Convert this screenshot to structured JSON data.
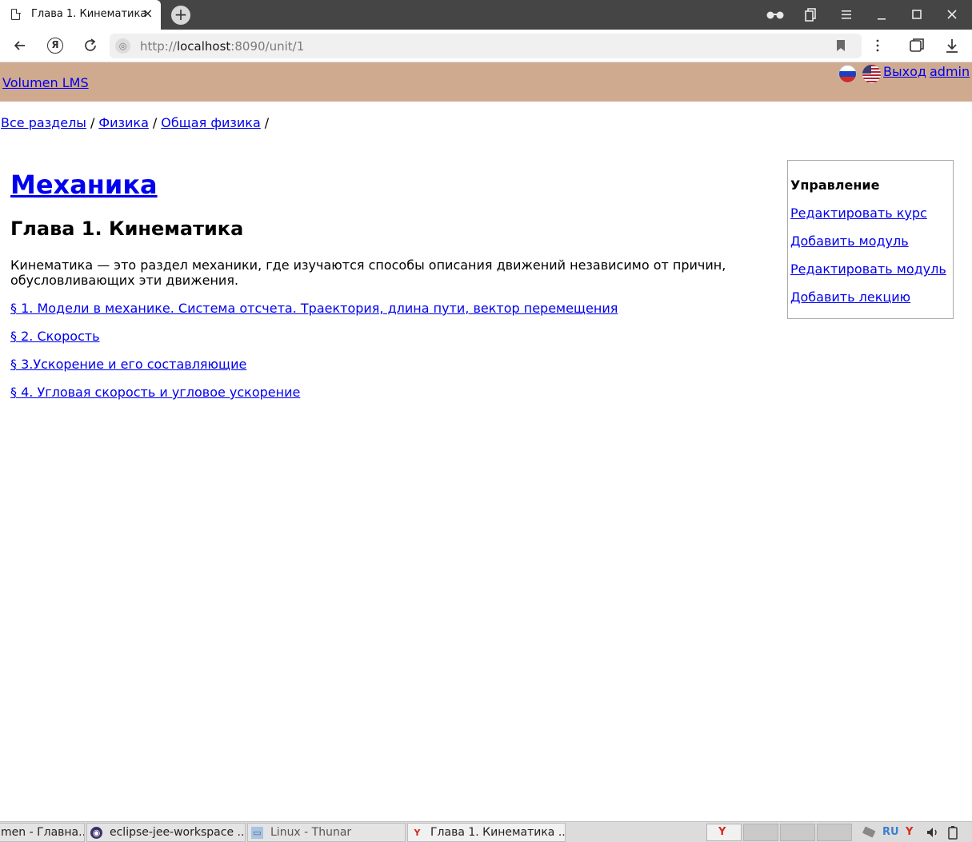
{
  "browser": {
    "tab_title": "Глава 1. Кинематика",
    "tab_close": "×",
    "new_tab": "+",
    "url_prefix": "http://",
    "url_host": "localhost",
    "url_rest": ":8090/unit/1",
    "icons": [
      "document-icon",
      "reader-glasses-icon",
      "tabs-icon",
      "menu-icon",
      "minimize-icon",
      "maximize-icon",
      "close-icon",
      "back-icon",
      "yandex-icon",
      "reload-icon",
      "site-info-icon",
      "bookmark-icon",
      "more-icon",
      "collections-icon",
      "download-icon"
    ]
  },
  "header": {
    "brand": "Volumen LMS",
    "logout": "Выход",
    "user": "admin",
    "flags": [
      "russian-flag-icon",
      "us-flag-icon"
    ]
  },
  "breadcrumb": {
    "items": [
      "Все разделы",
      "Физика",
      "Общая физика"
    ],
    "separator": "/"
  },
  "main": {
    "course_title": "Механика",
    "chapter_title": "Глава 1. Кинематика",
    "description": "Кинематика — это раздел механики, где изучаются способы описания движений независимо от причин, обусловливающих эти движения.",
    "lectures": [
      "§ 1. Модели в механике. Система отсчета. Траектория, длина пути, вектор перемещения",
      "§ 2. Скорость",
      "§ 3.Ускорение и его составляющие",
      "§ 4. Угловая скорость и угловое ускорение"
    ]
  },
  "management": {
    "title": "Управление",
    "links": [
      "Редактировать курс",
      "Добавить модуль",
      "Редактировать модуль",
      "Добавить лекцию"
    ]
  },
  "taskbar": {
    "tasks": [
      "men - Главна...",
      "eclipse-jee-workspace ...",
      "Linux - Thunar",
      "Глава 1. Кинематика ..."
    ],
    "language": "RU"
  },
  "colors": {
    "header_bg": "#cfaa8f",
    "link": "#0000ee",
    "tabbar_bg": "#454545"
  }
}
